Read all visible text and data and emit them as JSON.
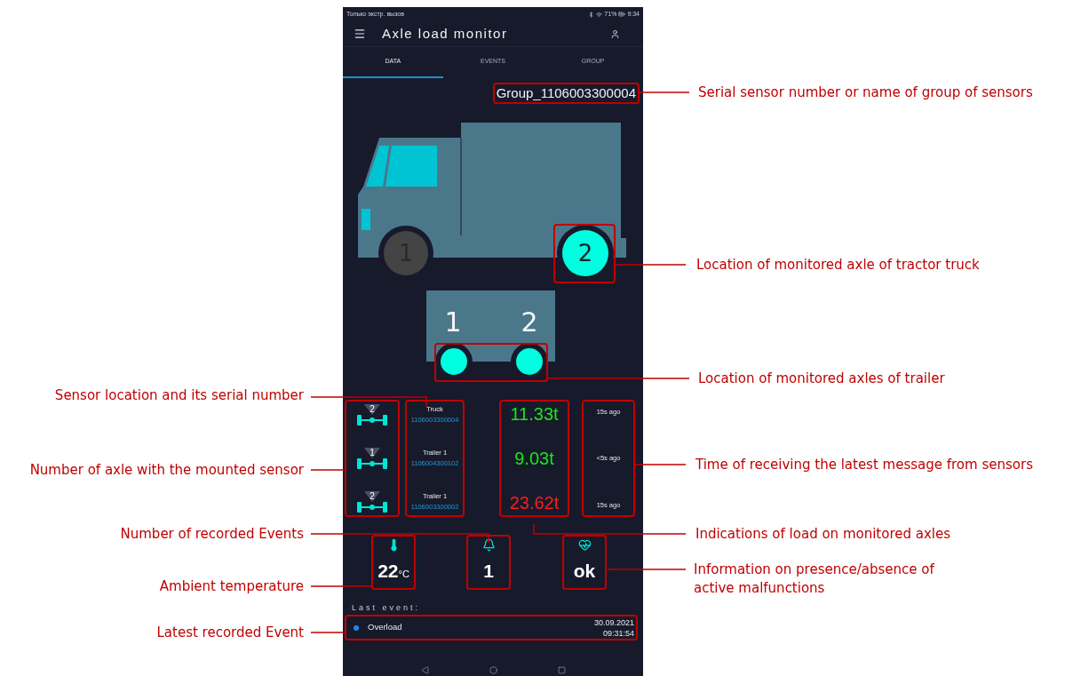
{
  "status_bar": {
    "carrier": "Только экстр. вызов",
    "battery": "71%",
    "time": "9:34"
  },
  "header": {
    "title": "Axle load monitor"
  },
  "tabs": [
    {
      "label": "DATA",
      "selected": true
    },
    {
      "label": "EVENTS",
      "selected": false
    },
    {
      "label": "GROUP",
      "selected": false
    }
  ],
  "group_name": "Group_1106003300004",
  "truck": {
    "axles": [
      {
        "label": "1",
        "monitored": false
      },
      {
        "label": "2",
        "monitored": true
      }
    ]
  },
  "trailer": {
    "axles": [
      {
        "label": "1",
        "monitored": true
      },
      {
        "label": "2",
        "monitored": true
      }
    ]
  },
  "sensors": [
    {
      "axle": "2",
      "location": "Truck",
      "serial": "1106003300004",
      "load": "11.33t",
      "overload": false,
      "last_message": "15s ago"
    },
    {
      "axle": "1",
      "location": "Trailer 1",
      "serial": "1106004300102",
      "load": "9.03t",
      "overload": false,
      "last_message": "<5s ago"
    },
    {
      "axle": "2",
      "location": "Trailer 1",
      "serial": "1106003300002",
      "load": "23.62t",
      "overload": true,
      "last_message": "15s ago"
    }
  ],
  "stats": {
    "temperature": "22",
    "temperature_unit": "°C",
    "events": "1",
    "malfunctions": "ok"
  },
  "last_event": {
    "label": "Last event:",
    "name": "Overload",
    "color": "#1e88e5",
    "date": "30.09.2021",
    "time": "09:31:54"
  },
  "annotations": [
    "Serial sensor number or name of group of sensors",
    "Location of monitored axle of tractor truck",
    "Location of monitored axles of trailer",
    "Time of receiving the latest message from sensors",
    "Indications of load on monitored axles",
    "Information on presence/absence of active malfunctions",
    "Sensor location and its serial number",
    "Number of axle with the mounted sensor",
    "Number of recorded Events",
    "Ambient temperature",
    "Latest recorded Event"
  ]
}
